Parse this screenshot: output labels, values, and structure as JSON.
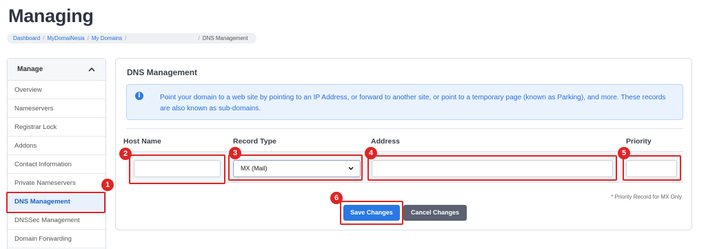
{
  "page": {
    "title": "Managing"
  },
  "breadcrumb": {
    "items": [
      "Dashboard",
      "MyDomaiNesia",
      "My Domains"
    ],
    "current": "DNS Management"
  },
  "sidebar": {
    "header": "Manage",
    "items": [
      {
        "label": "Overview"
      },
      {
        "label": "Nameservers"
      },
      {
        "label": "Registrar Lock"
      },
      {
        "label": "Addons"
      },
      {
        "label": "Contact Information"
      },
      {
        "label": "Private Nameservers"
      },
      {
        "label": "DNS Management",
        "active": true
      },
      {
        "label": "DNSSec Management"
      },
      {
        "label": "Domain Forwarding"
      }
    ]
  },
  "main": {
    "title": "DNS Management",
    "info_text": "Point your domain to a web site by pointing to an IP Address, or forward to another site, or point to a temporary page (known as Parking), and more. These records are also known as sub-domains.",
    "columns": {
      "host": "Host Name",
      "type": "Record Type",
      "address": "Address",
      "priority": "Priority"
    },
    "form": {
      "host_value": "",
      "record_type_selected": "MX (Mail)",
      "address_value": "",
      "priority_value": ""
    },
    "note": "* Priority Record for MX Only",
    "save_label": "Save Changes",
    "cancel_label": "Cancel Changes"
  },
  "annotations": {
    "badges": [
      "1",
      "2",
      "3",
      "4",
      "5",
      "6"
    ],
    "color": "#e02424"
  },
  "colors": {
    "accent": "#2a78e4",
    "secondary": "#5b6170",
    "info_bg": "#eaf3fd"
  }
}
